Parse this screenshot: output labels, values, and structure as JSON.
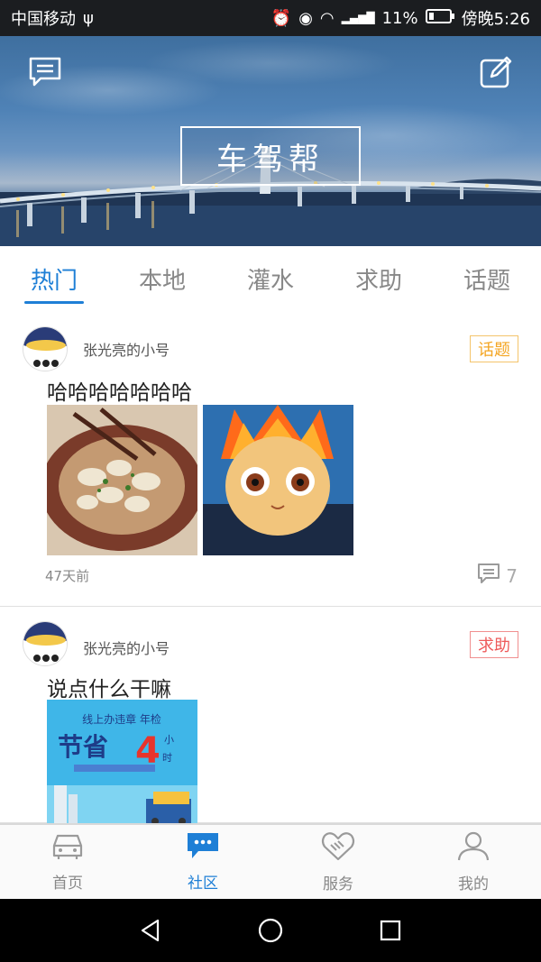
{
  "status_bar": {
    "carrier": "中国移动",
    "usb_icon": "usb-icon",
    "battery_percent": "11%",
    "time": "傍晚5:26"
  },
  "hero": {
    "title": "车驾帮",
    "left_icon": "message-icon",
    "right_icon": "edit-icon"
  },
  "tabs": [
    {
      "label": "热门",
      "active": true
    },
    {
      "label": "本地",
      "active": false
    },
    {
      "label": "灌水",
      "active": false
    },
    {
      "label": "求助",
      "active": false
    },
    {
      "label": "话题",
      "active": false
    }
  ],
  "posts": [
    {
      "username": "张光亮的小号",
      "badge": "话题",
      "text": "哈哈哈哈哈哈哈",
      "time": "47天前",
      "comment_count": "7",
      "images": [
        "wonton-soup-photo",
        "fire-cat-cartoon-photo"
      ]
    },
    {
      "username": "张光亮的小号",
      "badge": "求助",
      "text": "说点什么干嘛",
      "images": [
        "promo-poster"
      ],
      "promo_line1": "线上办违章 年检",
      "promo_big": "节省",
      "promo_num": "4",
      "promo_unit1": "小",
      "promo_unit2": "时"
    }
  ],
  "bottom_nav": [
    {
      "label": "首页",
      "icon": "car-icon",
      "active": false
    },
    {
      "label": "社区",
      "icon": "chat-bubble-icon",
      "active": true
    },
    {
      "label": "服务",
      "icon": "handshake-icon",
      "active": false
    },
    {
      "label": "我的",
      "icon": "person-icon",
      "active": false
    }
  ],
  "colors": {
    "accent": "#1e7fd6",
    "badge_topic": "#f4a623",
    "badge_help": "#ee5a5a"
  }
}
